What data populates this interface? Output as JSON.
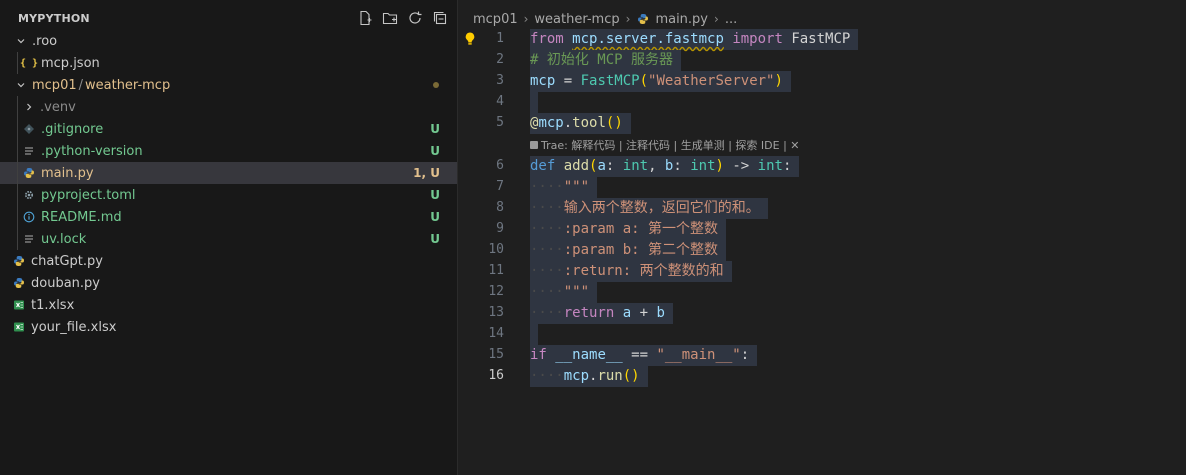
{
  "explorer": {
    "root_title": "MYPYTHON",
    "actions": [
      "new-file-icon",
      "new-folder-icon",
      "refresh-icon",
      "collapse-all-icon"
    ],
    "items": [
      {
        "name": ".roo",
        "kind": "folder-closed",
        "depth": 1,
        "status": "",
        "color": "#cccccc"
      },
      {
        "name": "mcp.json",
        "kind": "json",
        "depth": 2,
        "status": "",
        "color": "#cccccc"
      },
      {
        "name": "mcp01",
        "name_tail": "weather-mcp",
        "kind": "folder-open",
        "depth": 1,
        "status": "dot",
        "color": "#e2c08d"
      },
      {
        "name": ".venv",
        "kind": "folder-closed",
        "depth": 2,
        "status": "",
        "color": "#8b8b8b"
      },
      {
        "name": ".gitignore",
        "kind": "git",
        "depth": 2,
        "status": "U",
        "color": "#73c991"
      },
      {
        "name": ".python-version",
        "kind": "text",
        "depth": 2,
        "status": "U",
        "color": "#73c991"
      },
      {
        "name": "main.py",
        "kind": "python",
        "depth": 2,
        "status": "1, U",
        "color": "#e2c08d",
        "selected": true
      },
      {
        "name": "pyproject.toml",
        "kind": "gear",
        "depth": 2,
        "status": "U",
        "color": "#73c991"
      },
      {
        "name": "README.md",
        "kind": "info",
        "depth": 2,
        "status": "U",
        "color": "#73c991"
      },
      {
        "name": "uv.lock",
        "kind": "text",
        "depth": 2,
        "status": "U",
        "color": "#73c991"
      },
      {
        "name": "chatGpt.py",
        "kind": "python",
        "depth": 1,
        "status": "",
        "color": "#cccccc"
      },
      {
        "name": "douban.py",
        "kind": "python",
        "depth": 1,
        "status": "",
        "color": "#cccccc"
      },
      {
        "name": "t1.xlsx",
        "kind": "excel",
        "depth": 1,
        "status": "",
        "color": "#cccccc"
      },
      {
        "name": "your_file.xlsx",
        "kind": "excel",
        "depth": 1,
        "status": "",
        "color": "#cccccc"
      }
    ]
  },
  "editor": {
    "breadcrumb": [
      "mcp01",
      "weather-mcp",
      "main.py",
      "..."
    ],
    "code_lens": "Trae: 解释代码 | 注释代码 | 生成单测 | 探索 IDE | ✕",
    "active_line": 16,
    "lines": [
      {
        "n": 1,
        "tokens": [
          [
            "from",
            "kw"
          ],
          [
            " ",
            ""
          ],
          [
            "mcp.server.fastmcp",
            "squig"
          ],
          [
            " ",
            ""
          ],
          [
            "import",
            "kw"
          ],
          [
            " FastMCP",
            "op"
          ]
        ]
      },
      {
        "n": 2,
        "tokens": [
          [
            "# 初始化 MCP 服务器",
            "cm"
          ]
        ]
      },
      {
        "n": 3,
        "tokens": [
          [
            "mcp",
            "var"
          ],
          [
            " = ",
            "op"
          ],
          [
            "FastMCP",
            "cls"
          ],
          [
            "(",
            "par"
          ],
          [
            "\"WeatherServer\"",
            "str"
          ],
          [
            ")",
            "par"
          ]
        ]
      },
      {
        "n": 4,
        "tokens": []
      },
      {
        "n": 5,
        "tokens": [
          [
            "@",
            "fn"
          ],
          [
            "mcp",
            "var"
          ],
          [
            ".",
            "op"
          ],
          [
            "tool",
            "fn"
          ],
          [
            "()",
            "par"
          ]
        ]
      },
      {
        "lens": true
      },
      {
        "n": 6,
        "tokens": [
          [
            "def",
            "kw2"
          ],
          [
            " ",
            ""
          ],
          [
            "add",
            "fn"
          ],
          [
            "(",
            "par"
          ],
          [
            "a",
            "var"
          ],
          [
            ": ",
            "op"
          ],
          [
            "int",
            "cls"
          ],
          [
            ", ",
            "op"
          ],
          [
            "b",
            "var"
          ],
          [
            ": ",
            "op"
          ],
          [
            "int",
            "cls"
          ],
          [
            ")",
            "par"
          ],
          [
            " -> ",
            "op"
          ],
          [
            "int",
            "cls"
          ],
          [
            ":",
            "op"
          ]
        ]
      },
      {
        "n": 7,
        "tokens": [
          [
            "····",
            "ws"
          ],
          [
            "\"\"\"",
            "str"
          ]
        ]
      },
      {
        "n": 8,
        "tokens": [
          [
            "····",
            "ws"
          ],
          [
            "输入两个整数，返回它们的和。",
            "str"
          ]
        ]
      },
      {
        "n": 9,
        "tokens": [
          [
            "····",
            "ws"
          ],
          [
            ":param a: 第一个整数",
            "str"
          ]
        ]
      },
      {
        "n": 10,
        "tokens": [
          [
            "····",
            "ws"
          ],
          [
            ":param b: 第二个整数",
            "str"
          ]
        ]
      },
      {
        "n": 11,
        "tokens": [
          [
            "····",
            "ws"
          ],
          [
            ":return: 两个整数的和",
            "str"
          ]
        ]
      },
      {
        "n": 12,
        "tokens": [
          [
            "····",
            "ws"
          ],
          [
            "\"\"\"",
            "str"
          ]
        ]
      },
      {
        "n": 13,
        "tokens": [
          [
            "····",
            "ws"
          ],
          [
            "return",
            "kw"
          ],
          [
            " ",
            ""
          ],
          [
            "a",
            "var"
          ],
          [
            " + ",
            "op"
          ],
          [
            "b",
            "var"
          ]
        ]
      },
      {
        "n": 14,
        "tokens": []
      },
      {
        "n": 15,
        "tokens": [
          [
            "if",
            "kw"
          ],
          [
            " ",
            ""
          ],
          [
            "__name__",
            "var"
          ],
          [
            " == ",
            "op"
          ],
          [
            "\"__main__\"",
            "str"
          ],
          [
            ":",
            "op"
          ]
        ]
      },
      {
        "n": 16,
        "tokens": [
          [
            "····",
            "ws"
          ],
          [
            "mcp",
            "var"
          ],
          [
            ".",
            "op"
          ],
          [
            "run",
            "fn"
          ],
          [
            "()",
            "par"
          ]
        ]
      }
    ]
  }
}
